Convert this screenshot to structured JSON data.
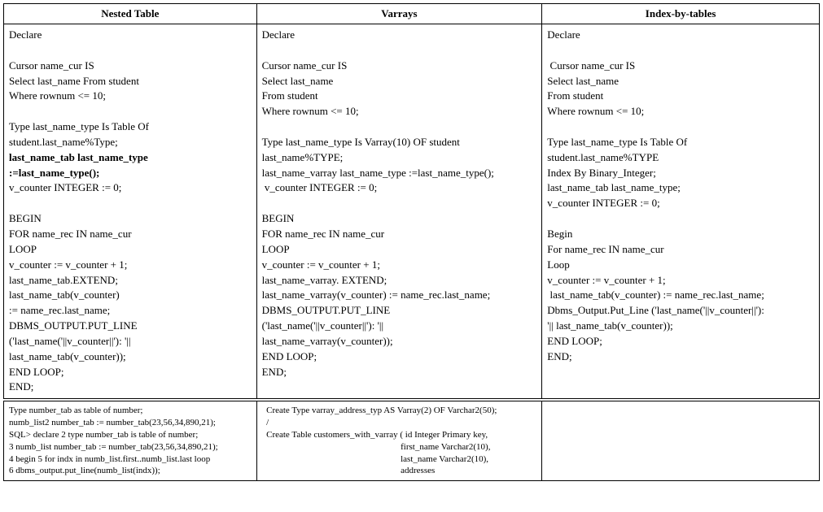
{
  "headers": [
    "Nested Table",
    "Varrays",
    "Index-by-tables"
  ],
  "col1": {
    "l1": "Declare",
    "l2": "",
    "l3": "Cursor name_cur IS",
    "l4": "Select last_name From student",
    "l5": "Where rownum <= 10;",
    "l6": "",
    "l7": "Type last_name_type Is Table Of",
    "l8": "student.last_name%Type;",
    "l9": "last_name_tab last_name_type",
    "l10": ":=last_name_type();",
    "l11": "v_counter INTEGER := 0;",
    "l12": "",
    "l13": "BEGIN",
    "l14": "FOR name_rec IN name_cur",
    "l15": "LOOP",
    "l16": "v_counter := v_counter + 1;",
    "l17": "last_name_tab.EXTEND;",
    "l18": "last_name_tab(v_counter)",
    "l19": ":= name_rec.last_name;",
    "l20": "DBMS_OUTPUT.PUT_LINE",
    "l21": "('last_name('||v_counter||'): '||",
    "l22": "last_name_tab(v_counter));",
    "l23": "END LOOP;",
    "l24": "END;"
  },
  "col2": {
    "l1": "Declare",
    "l2": "",
    "l3": "Cursor name_cur IS",
    "l4": "Select last_name",
    "l5": "From student",
    "l6": "Where rownum <= 10;",
    "l7": "",
    "l8": "Type last_name_type Is Varray(10) OF student",
    "l9": "last_name%TYPE;",
    "l10": "last_name_varray last_name_type :=last_name_type();",
    "l11": " v_counter INTEGER := 0;",
    "l12": "",
    "l13": "BEGIN",
    "l14": "FOR name_rec IN name_cur",
    "l15": "LOOP",
    "l16": "v_counter := v_counter + 1;",
    "l17": "last_name_varray. EXTEND;",
    "l18": "last_name_varray(v_counter) := name_rec.last_name;",
    "l19": "DBMS_OUTPUT.PUT_LINE",
    "l20": "('last_name('||v_counter||'): '||",
    "l21": "last_name_varray(v_counter));",
    "l22": "END LOOP;",
    "l23": "END;"
  },
  "col3": {
    "l1": "Declare",
    "l2": "",
    "l3": " Cursor name_cur IS",
    "l4": "Select last_name",
    "l5": "From student",
    "l6": "Where rownum <= 10;",
    "l7": "",
    "l8": "Type last_name_type Is Table Of",
    "l9": "student.last_name%TYPE",
    "l10": "Index By Binary_Integer;",
    "l11": "last_name_tab last_name_type;",
    "l12": "v_counter INTEGER := 0;",
    "l13": "",
    "l14": "Begin",
    "l15": "For name_rec IN name_cur",
    "l16": "Loop",
    "l17": "v_counter := v_counter + 1;",
    "l18": " last_name_tab(v_counter) := name_rec.last_name;",
    "l19": "Dbms_Output.Put_Line ('last_name('||v_counter||'):",
    "l20": "'|| last_name_tab(v_counter));",
    "l21": "END LOOP;",
    "l22": "END;"
  },
  "row2": {
    "c1": {
      "l1": "Type number_tab as table of number;",
      "l2": "numb_list2 number_tab := number_tab(23,56,34,890,21);",
      "l3": "SQL> declare 2 type number_tab is table of number;",
      "l4": "3 numb_list number_tab := number_tab(23,56,34,890,21);",
      "l5": "4 begin 5 for indx in numb_list.first..numb_list.last loop",
      "l6": "6 dbms_output.put_line(numb_list(indx));"
    },
    "c2": {
      "l1": "  Create Type varray_address_typ AS Varray(2) OF Varchar2(50);",
      "l2": "  /",
      "l3": "  Create Table customers_with_varray ( id Integer Primary key,",
      "l4": "                                                              first_name Varchar2(10),",
      "l5": "                                                              last_name Varchar2(10),",
      "l6": "                                                              addresses"
    },
    "c3": ""
  }
}
